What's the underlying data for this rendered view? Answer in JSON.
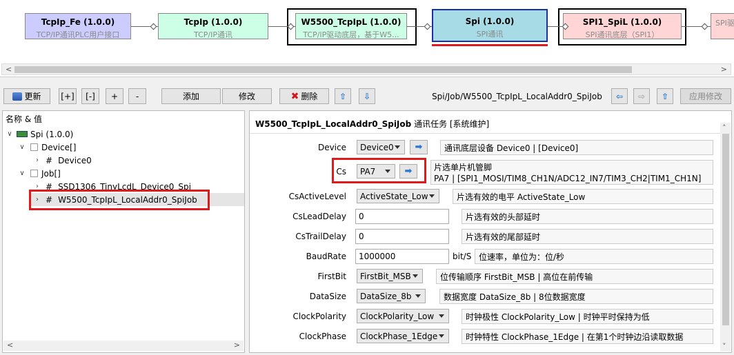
{
  "diagram": {
    "nodes": [
      {
        "title": "TcpIp_Fe (1.0.0)",
        "sub": "TCP/IP通讯PLC用户接口",
        "color": "#ccccff"
      },
      {
        "title": "TcpIp (1.0.0)",
        "sub": "TCP/IP通讯",
        "color": "#ccffe6"
      },
      {
        "title": "W5500_TcpIpL (1.0.0)",
        "sub": "TCP/IP驱动底层，基于W5...",
        "color": "#ccffe6"
      },
      {
        "title": "Spi (1.0.0)",
        "sub": "SPI通讯",
        "color": "#a7dbe6"
      },
      {
        "title": "SPI1_SpiL (1.0.0)",
        "sub": "SPI通讯底层（SPI1）",
        "color": "#ffd5d5"
      },
      {
        "title": "",
        "sub": "SPI驱",
        "color": "#ffd5d5"
      }
    ],
    "scroll_left": "<",
    "scroll_right": ">"
  },
  "toolbar": {
    "refresh": "更新",
    "expand": "[+]",
    "collapse": "[-]",
    "plus": "+",
    "minus": "-",
    "add": "添加",
    "modify": "修改",
    "delete": "删除",
    "path": "Spi/Job/W5500_TcpIpL_LocalAddr0_SpiJob",
    "apply": "应用修改"
  },
  "tree": {
    "header": "名称 & 值",
    "items": [
      {
        "label": "Spi (1.0.0)"
      },
      {
        "label": "Device[]"
      },
      {
        "label": "Device0"
      },
      {
        "label": "Job[]"
      },
      {
        "label": "SSD1306_TinyLcdL_Device0_Spi"
      },
      {
        "label": "W5500_TcpIpL_LocalAddr0_SpiJob"
      }
    ],
    "hash": "#"
  },
  "props": {
    "header_name": "W5500_TcpIpL_LocalAddr0_SpiJob",
    "header_desc": "通讯任务 [系统维护]",
    "rows": [
      {
        "label": "Device",
        "value": "Device0",
        "desc": "通讯底层设备 Device0 | [Device0]"
      },
      {
        "label": "Cs",
        "value": "PA7",
        "desc1": "片选单片机管脚",
        "desc2": "PA7 | [SPI1_MOSI/TIM8_CH1N/ADC12_IN7/TIM3_CH2|TIM1_CH1N]"
      },
      {
        "label": "CsActiveLevel",
        "value": "ActiveState_Low",
        "desc": "片选有效的电平 ActiveState_Low"
      },
      {
        "label": "CsLeadDelay",
        "value": "0",
        "desc": "片选有效的头部延时"
      },
      {
        "label": "CsTrailDelay",
        "value": "0",
        "desc": "片选有效的尾部延时"
      },
      {
        "label": "BaudRate",
        "value": "1000000",
        "unit": "bit/S",
        "desc": "位速率，单位为：位/秒"
      },
      {
        "label": "FirstBit",
        "value": "FirstBit_MSB",
        "desc": "位传输顺序 FirstBit_MSB | 高位在前传输"
      },
      {
        "label": "DataSize",
        "value": "DataSize_8b",
        "desc": "数据宽度 DataSize_8b | 8位数据宽度"
      },
      {
        "label": "ClockPolarity",
        "value": "ClockPolarity_Low",
        "desc": "时钟极性 ClockPolarity_Low | 时钟平时保持为低"
      },
      {
        "label": "ClockPhase",
        "value": "ClockPhase_1Edge",
        "desc": "时钟特性 ClockPhase_1Edge | 在第1个时钟边沿读取数据"
      }
    ]
  },
  "colors": {
    "accent": "#2b78d0",
    "highlight": "#e0191c",
    "selected_node_border": "#1a2fa8"
  }
}
